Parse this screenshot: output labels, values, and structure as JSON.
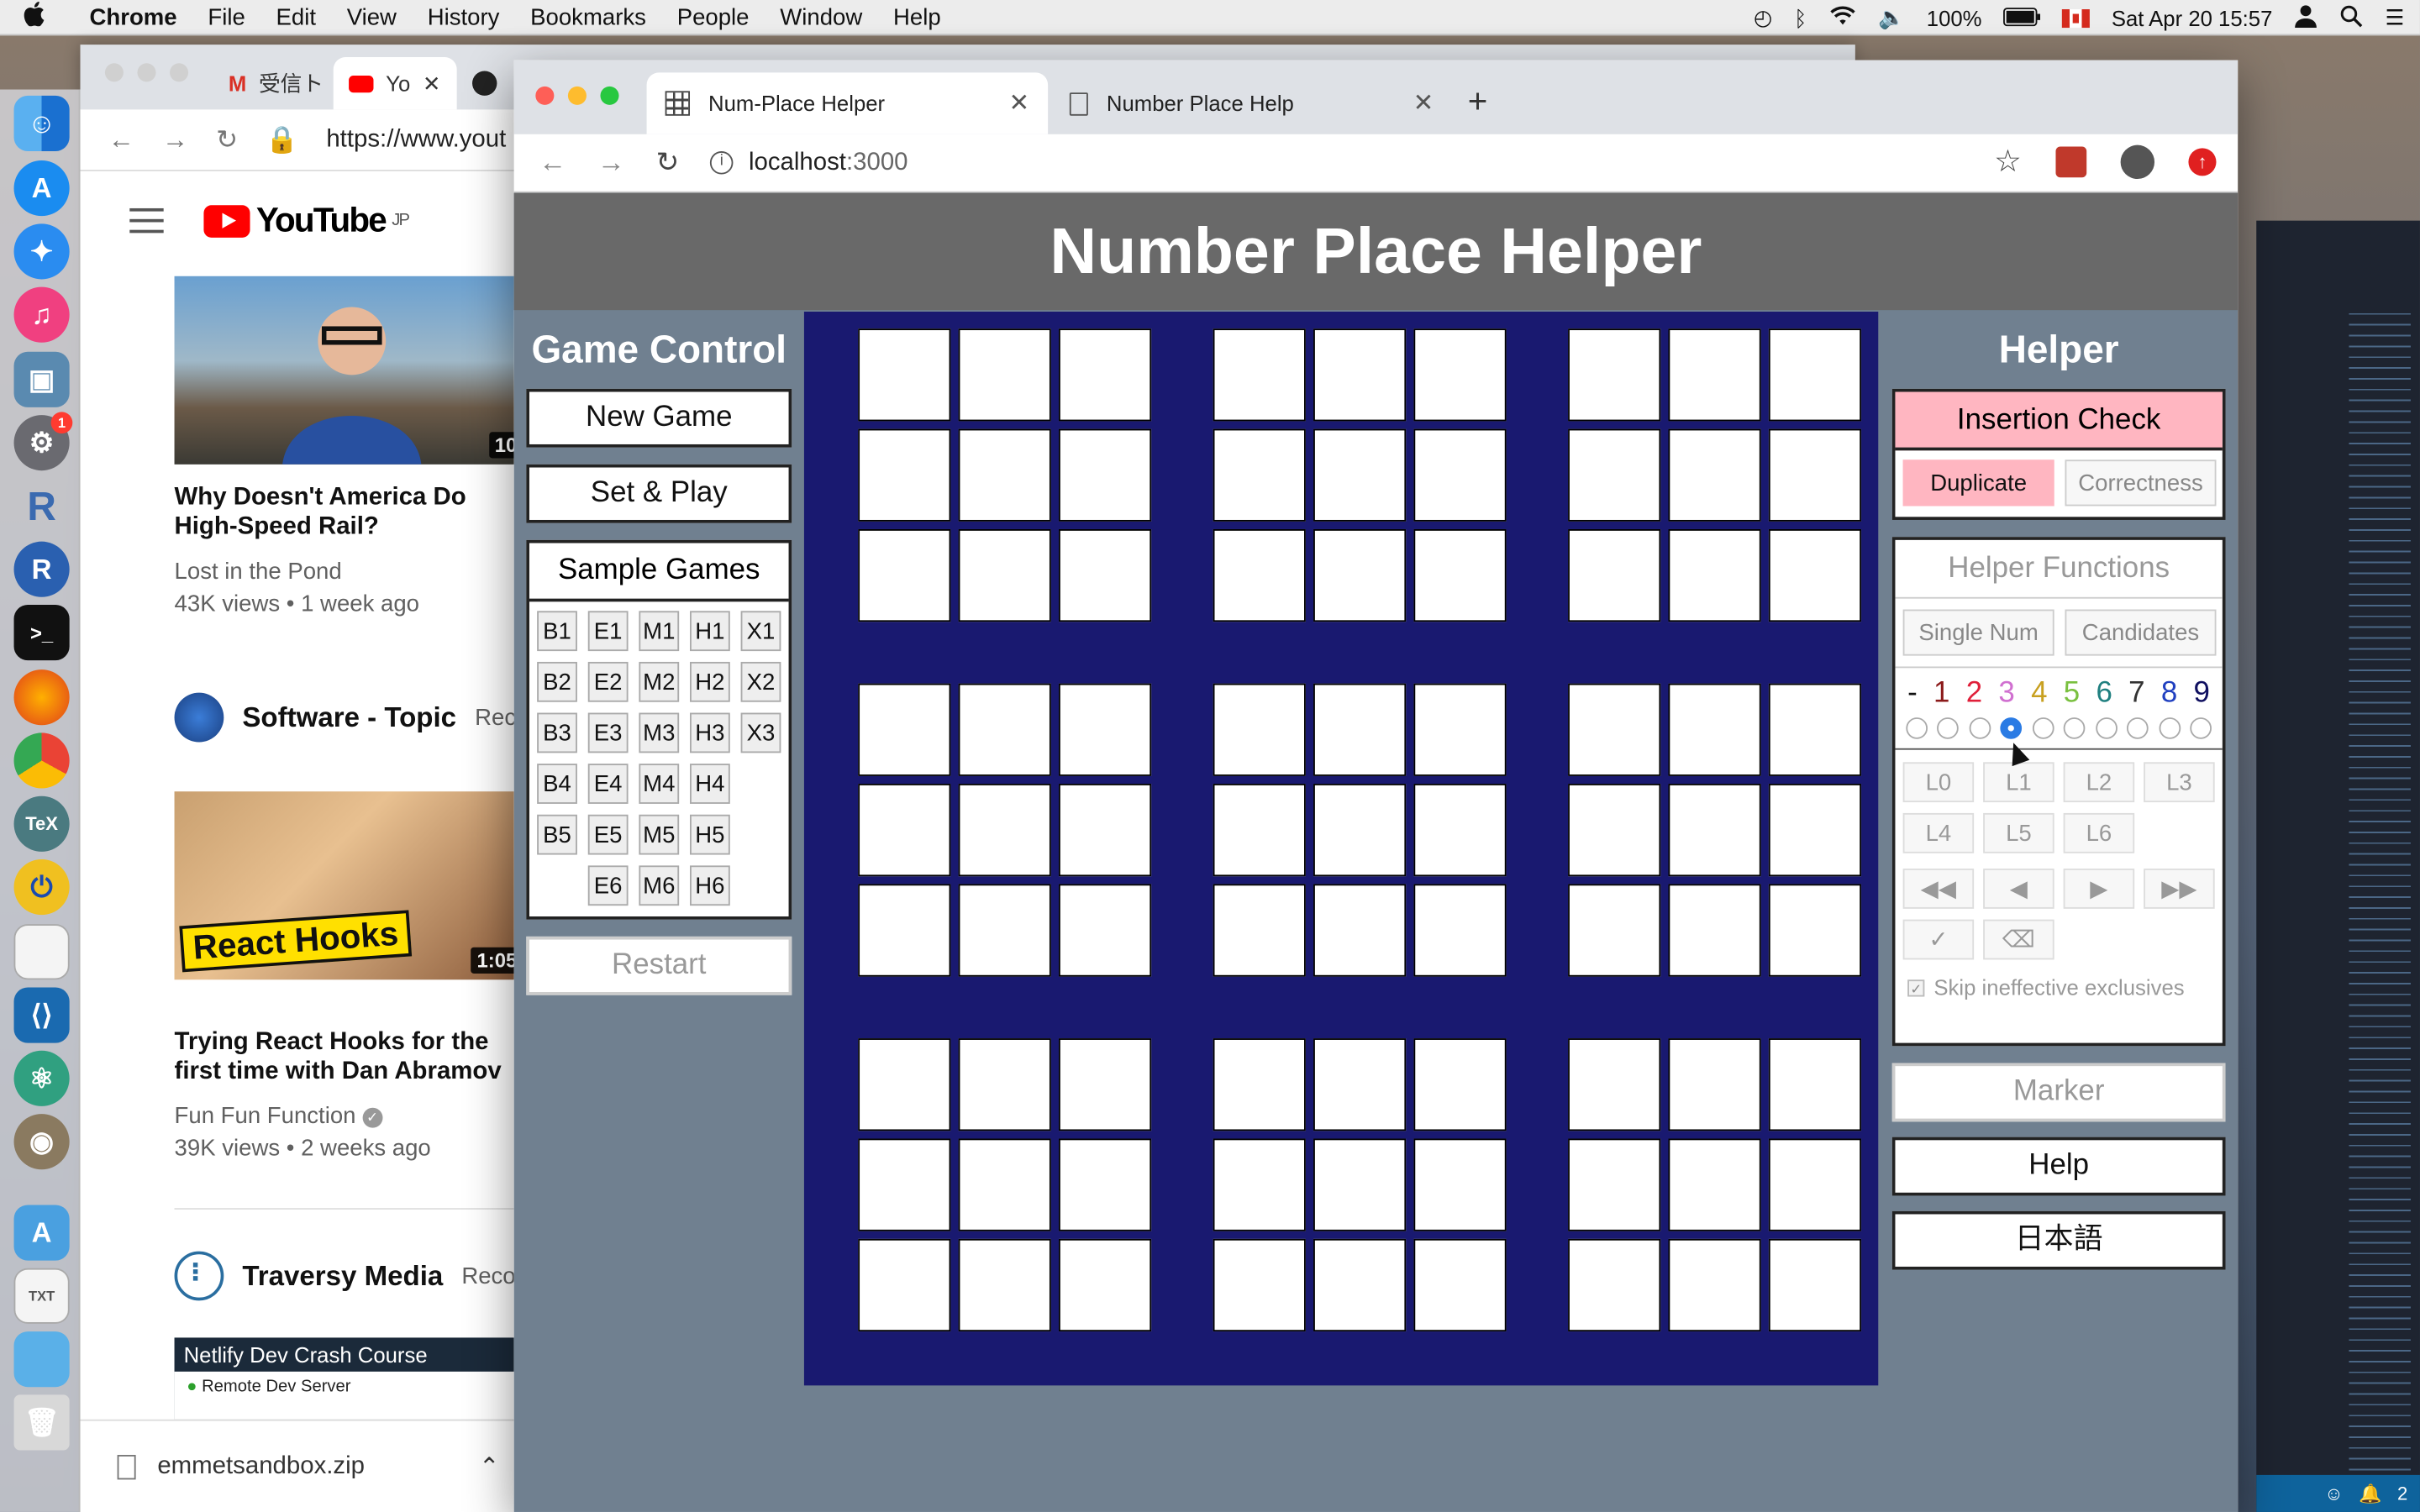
{
  "menubar": {
    "app": "Chrome",
    "items": [
      "File",
      "Edit",
      "View",
      "History",
      "Bookmarks",
      "People",
      "Window",
      "Help"
    ],
    "battery": "100%",
    "clock": "Sat Apr 20  15:57"
  },
  "dock": {
    "mail_badge": "1",
    "items": [
      "finder-icon",
      "app-store-icon",
      "safari-icon",
      "itunes-icon",
      "preview-icon",
      "system-preferences-icon",
      "r-studio-icon",
      "r-icon",
      "terminal-icon",
      "firefox-icon",
      "chrome-icon",
      "tex-icon",
      "toggl-icon",
      "textedit-icon",
      "vscode-icon",
      "atom-icon",
      "gimp-icon",
      "applications-folder-icon",
      "text-file-icon",
      "folder-icon",
      "trash-icon"
    ]
  },
  "yt_window": {
    "tab1": "受信ト",
    "tab2": "Yo",
    "url": "https://www.yout",
    "logo": "YouTube",
    "logo_region": "JP",
    "video1": {
      "title": "Why Doesn't America Do High-Speed Rail?",
      "channel": "Lost in the Pond",
      "meta": "43K views • 1 week ago",
      "duration": "10"
    },
    "section1": {
      "title": "Software - Topic",
      "reco": "Rec"
    },
    "video2": {
      "title": "Trying React Hooks for the first time with Dan Abramov",
      "channel": "Fun Fun Function",
      "meta": "39K views • 2 weeks ago",
      "duration": "1:05",
      "thumb_text": "React Hooks"
    },
    "section2": {
      "title": "Traversy Media",
      "reco": "Reco"
    },
    "video3_thumb": "Netlify Dev Crash Course",
    "video3_sub": "Remote Dev Server",
    "download": "emmetsandbox.zip"
  },
  "editor": {
    "notifications": "2"
  },
  "browser": {
    "tabs": [
      {
        "title": "Num-Place Helper",
        "active": true
      },
      {
        "title": "Number Place Help",
        "active": false
      }
    ],
    "url_host": "localhost",
    "url_port": ":3000"
  },
  "app": {
    "title": "Number Place Helper",
    "game_control": {
      "title": "Game Control",
      "new_game": "New Game",
      "set_play": "Set & Play",
      "sample_games_title": "Sample Games",
      "samples": [
        [
          "B1",
          "E1",
          "M1",
          "H1",
          "X1"
        ],
        [
          "B2",
          "E2",
          "M2",
          "H2",
          "X2"
        ],
        [
          "B3",
          "E3",
          "M3",
          "H3",
          "X3"
        ],
        [
          "B4",
          "E4",
          "M4",
          "H4",
          ""
        ],
        [
          "B5",
          "E5",
          "M5",
          "H5",
          ""
        ],
        [
          "",
          "E6",
          "M6",
          "H6",
          ""
        ]
      ],
      "restart": "Restart"
    },
    "helper": {
      "title": "Helper",
      "insertion_check": "Insertion Check",
      "duplicate": "Duplicate",
      "correctness": "Correctness",
      "helper_functions": "Helper Functions",
      "single_num": "Single Num",
      "candidates": "Candidates",
      "digits": [
        {
          "label": "-",
          "color": "#111111"
        },
        {
          "label": "1",
          "color": "#8b1a1a"
        },
        {
          "label": "2",
          "color": "#e0203a"
        },
        {
          "label": "3",
          "color": "#d070d0"
        },
        {
          "label": "4",
          "color": "#c8a020"
        },
        {
          "label": "5",
          "color": "#7ac040"
        },
        {
          "label": "6",
          "color": "#208080"
        },
        {
          "label": "7",
          "color": "#333333"
        },
        {
          "label": "8",
          "color": "#2040c0"
        },
        {
          "label": "9",
          "color": "#101060"
        }
      ],
      "selected_digit_index": 3,
      "levels": [
        "L0",
        "L1",
        "L2",
        "L3",
        "L4",
        "L5",
        "L6"
      ],
      "nav": [
        "first-icon",
        "prev-icon",
        "next-icon",
        "last-icon"
      ],
      "actions": [
        "check-icon",
        "eraser-icon"
      ],
      "skip_label": "Skip ineffective exclusives",
      "skip_checked": true,
      "marker": "Marker",
      "help": "Help",
      "japanese": "日本語"
    }
  }
}
